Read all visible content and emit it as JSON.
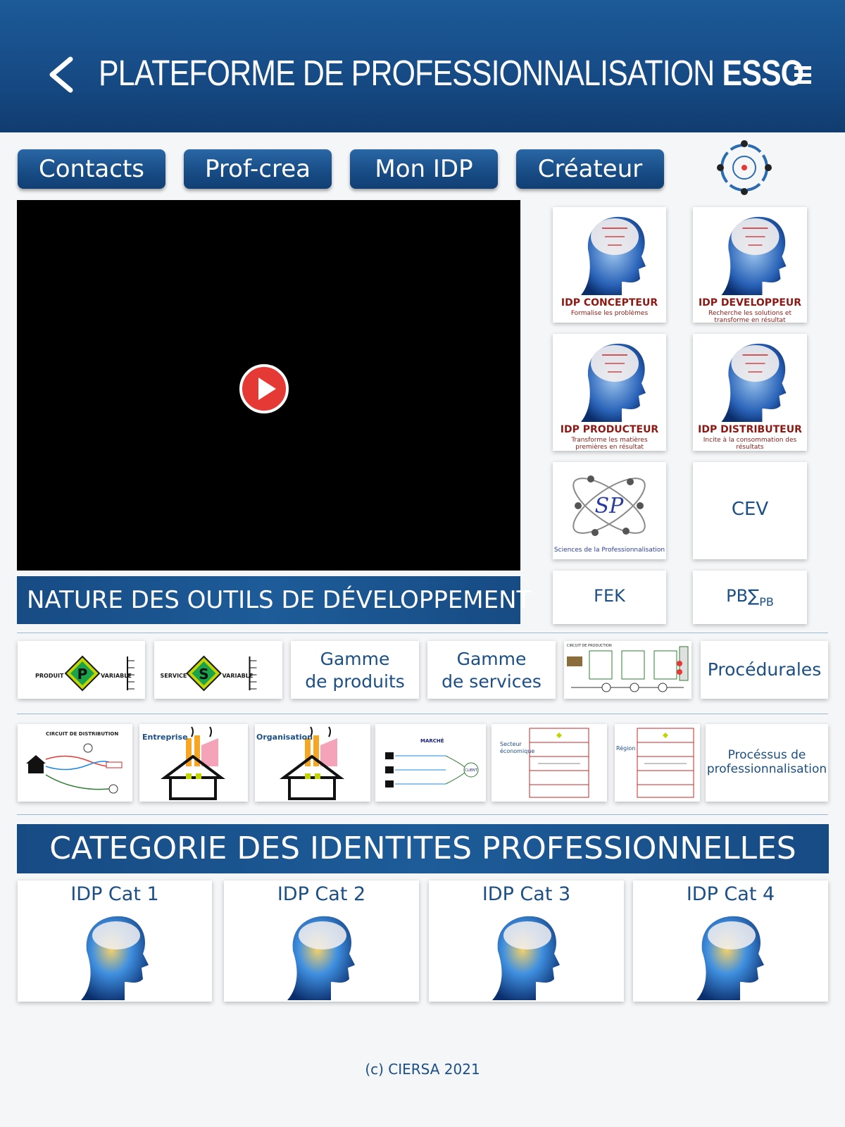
{
  "header": {
    "title_plain": "PLATEFORME DE PROFESSIONNALISATION",
    "title_bold": "ESSO",
    "back_icon": "chevron-left-icon",
    "menu_icon": "hamburger-menu-icon"
  },
  "nav": {
    "buttons": [
      "Contacts",
      "Prof-crea",
      "Mon IDP",
      "Créateur"
    ]
  },
  "logo": {
    "name": "ciersa-logo"
  },
  "video": {
    "play_icon": "play-icon"
  },
  "nature_banner": "NATURE DES OUTILS DE DÉVELOPPEMENT",
  "idp_tiles": [
    {
      "title": "IDP CONCEPTEUR",
      "subtitle": "Formalise les problèmes"
    },
    {
      "title": "IDP DEVELOPPEUR",
      "subtitle": "Recherche les solutions et transforme en résultat"
    },
    {
      "title": "IDP PRODUCTEUR",
      "subtitle": "Transforme les matières premières en résultat"
    },
    {
      "title": "IDP DISTRIBUTEUR",
      "subtitle": "Incite à la consommation des résultats"
    }
  ],
  "sp_tile": {
    "label": "Sciences de la Professionnalisation"
  },
  "text_tiles": {
    "cev": "CEV",
    "fek": "FEK",
    "pb": "PB∑",
    "pb_sub": "PB"
  },
  "tools_row1": {
    "produit": {
      "left": "PRODUIT",
      "letter": "P",
      "right": "VARIABLE"
    },
    "service": {
      "left": "SERVICE",
      "letter": "S",
      "right": "VARIABLE"
    },
    "gamme_produits": [
      "Gamme",
      "de produits"
    ],
    "gamme_services": [
      "Gamme",
      "de services"
    ],
    "circuit_production": "CIRCUIT DE PRODUCTION",
    "procedurales": "Procédurales"
  },
  "tools_row2": {
    "circuit_distribution": "CIRCUIT DE DISTRIBUTION",
    "entreprise": "Entreprise",
    "organisation": "Organisation",
    "marche": "MARCHÉ",
    "client": "CLIENT",
    "secteur": "Secteur économique",
    "region": "Région",
    "processus": [
      "Procéssus de",
      "professionnalisation"
    ]
  },
  "category_banner": "CATEGORIE DES IDENTITES PROFESSIONNELLES",
  "categories": [
    "IDP Cat 1",
    "IDP Cat 2",
    "IDP Cat 3",
    "IDP Cat 4"
  ],
  "footer": "(c) CIERSA 2021",
  "colors": {
    "brand_blue": "#174b84",
    "text_blue": "#1b4f86",
    "accent_red": "#e53935",
    "idp_red": "#8b1a14"
  }
}
